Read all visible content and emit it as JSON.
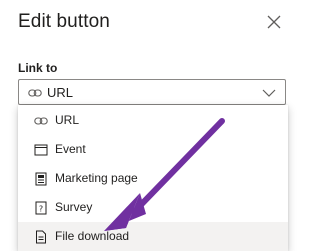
{
  "dialog": {
    "title": "Edit button",
    "close_icon": "close-icon"
  },
  "link_field": {
    "label": "Link to",
    "selected_value": "URL",
    "selected_icon": "link-icon"
  },
  "dropdown": {
    "options": [
      {
        "label": "URL",
        "icon": "link-icon"
      },
      {
        "label": "Event",
        "icon": "calendar-icon"
      },
      {
        "label": "Marketing page",
        "icon": "marketing-page-icon"
      },
      {
        "label": "Survey",
        "icon": "survey-icon"
      },
      {
        "label": "File download",
        "icon": "file-icon"
      }
    ],
    "hovered_index": 4
  },
  "colors": {
    "annotation_arrow": "#7030a0",
    "hover_background": "#f3f2f1",
    "border": "#8a8886"
  }
}
